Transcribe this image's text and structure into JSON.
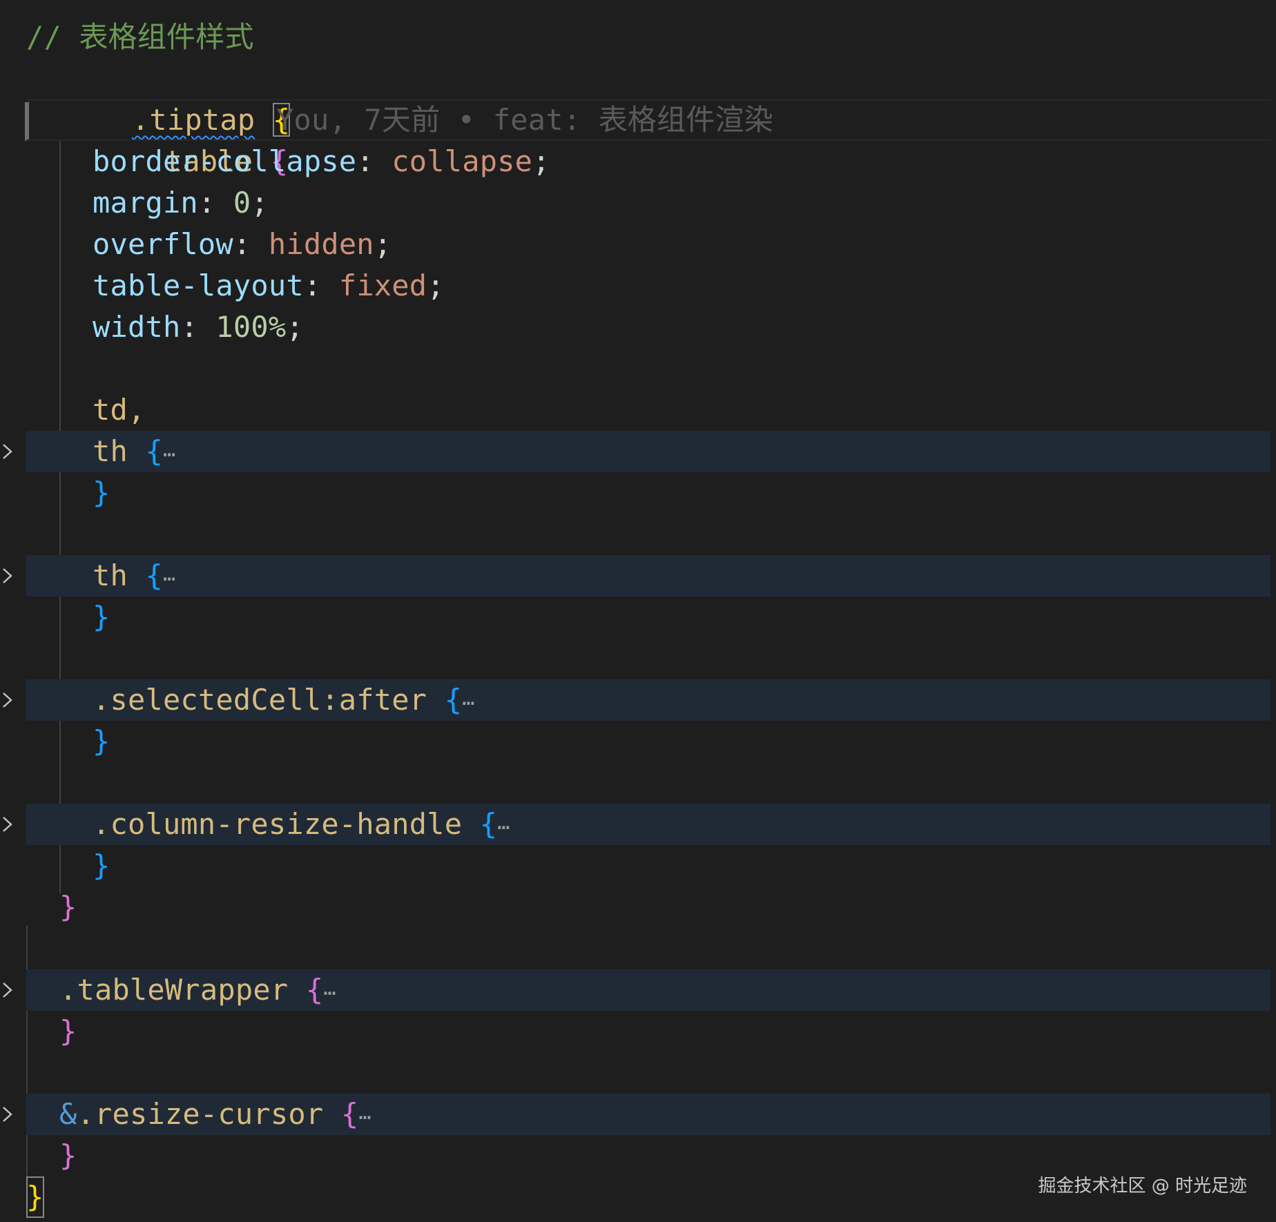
{
  "editor": {
    "lines": {
      "comment": "// 表格组件样式",
      "root_selector": ".tiptap",
      "table_selector": "table",
      "blame": "You, 7天前 • feat: 表格组件渲染",
      "prop_border": "border-collapse",
      "val_border": "collapse",
      "prop_margin": "margin",
      "val_margin": "0",
      "prop_overflow": "overflow",
      "val_overflow": "hidden",
      "prop_layout": "table-layout",
      "val_layout": "fixed",
      "prop_width": "width",
      "val_width": "100%",
      "sel_td": "td,",
      "sel_th1": "th",
      "sel_th2": "th",
      "sel_selected": ".selectedCell:after",
      "sel_resize_handle": ".column-resize-handle",
      "sel_wrapper": ".tableWrapper",
      "sel_resize_amp": "&",
      "sel_resize_cursor": ".resize-cursor"
    },
    "folded_marker": "⋯"
  },
  "watermark": "掘金技术社区 @ 时光足迹",
  "colors": {
    "background": "#1e1e1e",
    "folded_bg": "#1f2a36",
    "comment": "#6a9955",
    "selector": "#d7ba7d",
    "property": "#9cdcfe",
    "string": "#ce9178",
    "number": "#b5cea8",
    "bracket_level1": "#ffd700",
    "bracket_level2": "#da70d6",
    "bracket_level3": "#179fff"
  }
}
